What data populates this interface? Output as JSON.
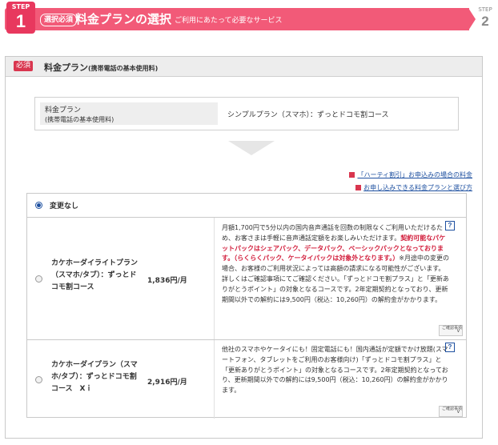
{
  "step_header": {
    "step_label": "STEP",
    "step_number": "1",
    "required_label": "選択必須",
    "title": "料金プランの選択",
    "subtitle": "ご利用にあたって必要なサービス",
    "next_step_label": "STEP",
    "next_step_number": "2",
    "color_primary": "#f25a78"
  },
  "section": {
    "required_tag": "必須",
    "title": "料金プラン",
    "title_note": "(携帯電話の基本使用料)"
  },
  "current_plan": {
    "label": "料金プラン",
    "label_sub": "(携帯電話の基本使用料)",
    "value": "シンプルプラン（スマホ）：ずっとドコモ割コース"
  },
  "links": [
    {
      "icon": "link-square-icon",
      "text": "「ハーティ割引」お申込みの場合の料金"
    },
    {
      "icon": "link-square-icon",
      "text": "お申し込みできる料金プランと選び方"
    }
  ],
  "options": {
    "no_change": {
      "label": "変更なし",
      "selected": true
    },
    "plans": [
      {
        "name": "カケホーダイライトプラン（スマホ/タブ）：ずっとドコモ割コース",
        "price": "1,836円/月",
        "desc_before": "月額1,700円で5分以内の国内音声通話を回数の制限なくご利用いただけるため、お客さまは手軽に音声通話定額をお楽しみいただけます。",
        "desc_red": "契約可能なパケットパックはシェアパック、データパック、ベーシックパックとなっております。（らくらくパック、ケータイパックは対象外となります。）",
        "desc_after": "※月途中の変更の場合、お客様のご利用状況によっては高額の請求になる可能性がございます。詳しくはご確認事項にてご確認ください。「ずっとドコモ割プラス」と「更新ありがとうポイント」の対象となるコースです。2年定期契約となっており、更新期間以外での解約には9,500円（税込：10,260円）の解約金がかかります。",
        "help": "?",
        "confirm": "ご確認事項",
        "selected": false
      },
      {
        "name": "カケホーダイプラン（スマホ/タブ）：ずっとドコモ割コース　Xｉ",
        "price": "2,916円/月",
        "desc_before": "",
        "desc_red": "",
        "desc_after": "他社のスマホやケータイにも！固定電話にも！国内通話が定額でかけ放題(スマートフォン、タブレットをご利用のお客様向け)「ずっとドコモ割プラス」と「更新ありがとうポイント」の対象となるコースです。2年定期契約となっており、更新期間以外での解約には9,500円（税込：10,260円）の解約金がかかります。",
        "help": "?",
        "confirm": "ご確認事項",
        "selected": false
      }
    ]
  }
}
